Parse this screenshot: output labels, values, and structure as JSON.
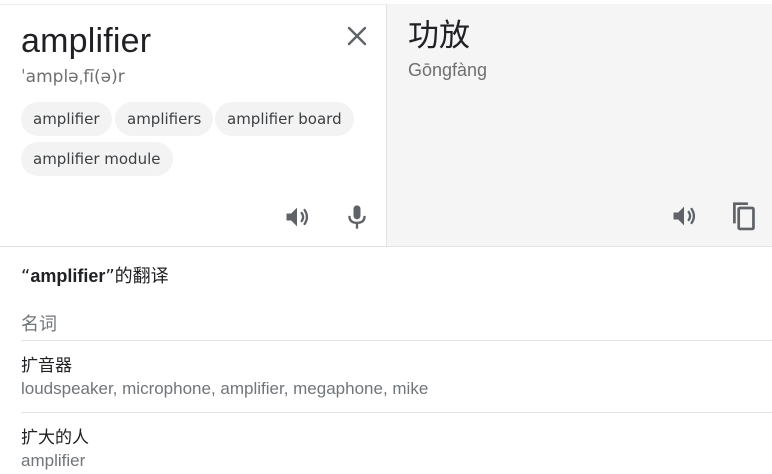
{
  "source": {
    "text": "amplifier",
    "phonetic": "ˈampləˌfī(ə)r",
    "suggestions": [
      "amplifier",
      "amplifiers",
      "amplifier board",
      "amplifier module"
    ]
  },
  "target": {
    "text": "功放",
    "romanization": "Gōngfàng"
  },
  "dictionary": {
    "title_prefix": "“",
    "title_word": "amplifier",
    "title_suffix": "”的翻译",
    "part_of_speech": "名词",
    "entries": [
      {
        "word": "扩音器",
        "synonyms": "loudspeaker, microphone, amplifier, megaphone, mike"
      },
      {
        "word": "扩大的人",
        "synonyms": "amplifier"
      }
    ]
  },
  "icons": {
    "clear": "close-icon",
    "source_listen": "speaker-icon",
    "mic": "microphone-icon",
    "target_listen": "speaker-icon",
    "copy": "copy-icon"
  },
  "colors": {
    "icon": "#5f6368",
    "muted": "#70757a",
    "target_bg": "#f5f5f5",
    "chip_bg": "#f3f3f3"
  }
}
